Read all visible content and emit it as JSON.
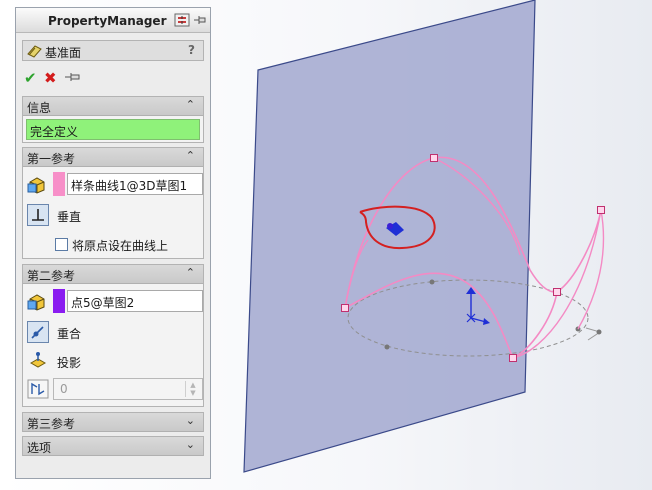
{
  "panel": {
    "title": "PropertyManager",
    "feature_name": "基准面",
    "help_glyph": "?"
  },
  "groups": {
    "info": {
      "title": "信息",
      "status": "完全定义",
      "status_color": "#8ff27a"
    },
    "first_ref": {
      "title": "第一参考",
      "reference": "样条曲线1@3D草图1",
      "swatch_color": "#f78fc8",
      "constraint": "垂直",
      "checkbox_label": "将原点设在曲线上",
      "checkbox_checked": false
    },
    "second_ref": {
      "title": "第二参考",
      "reference": "点5@草图2",
      "swatch_color": "#8a1cf0",
      "option_coincident": "重合",
      "option_project": "投影",
      "distance_value": "0"
    },
    "third_ref": {
      "title": "第三参考"
    },
    "options": {
      "title": "选项"
    }
  },
  "icons": {
    "ok": "check-icon",
    "cancel": "cancel-x-icon",
    "pin": "pushpin-icon"
  },
  "colors": {
    "plane_fill": "#a8aed3",
    "plane_edge": "#3b4a8a",
    "curve": "#f48ac4",
    "annotation_circle": "#d42020",
    "sketch_ellipse": "#8f8f8f",
    "axis_blue": "#1f2fd6"
  }
}
